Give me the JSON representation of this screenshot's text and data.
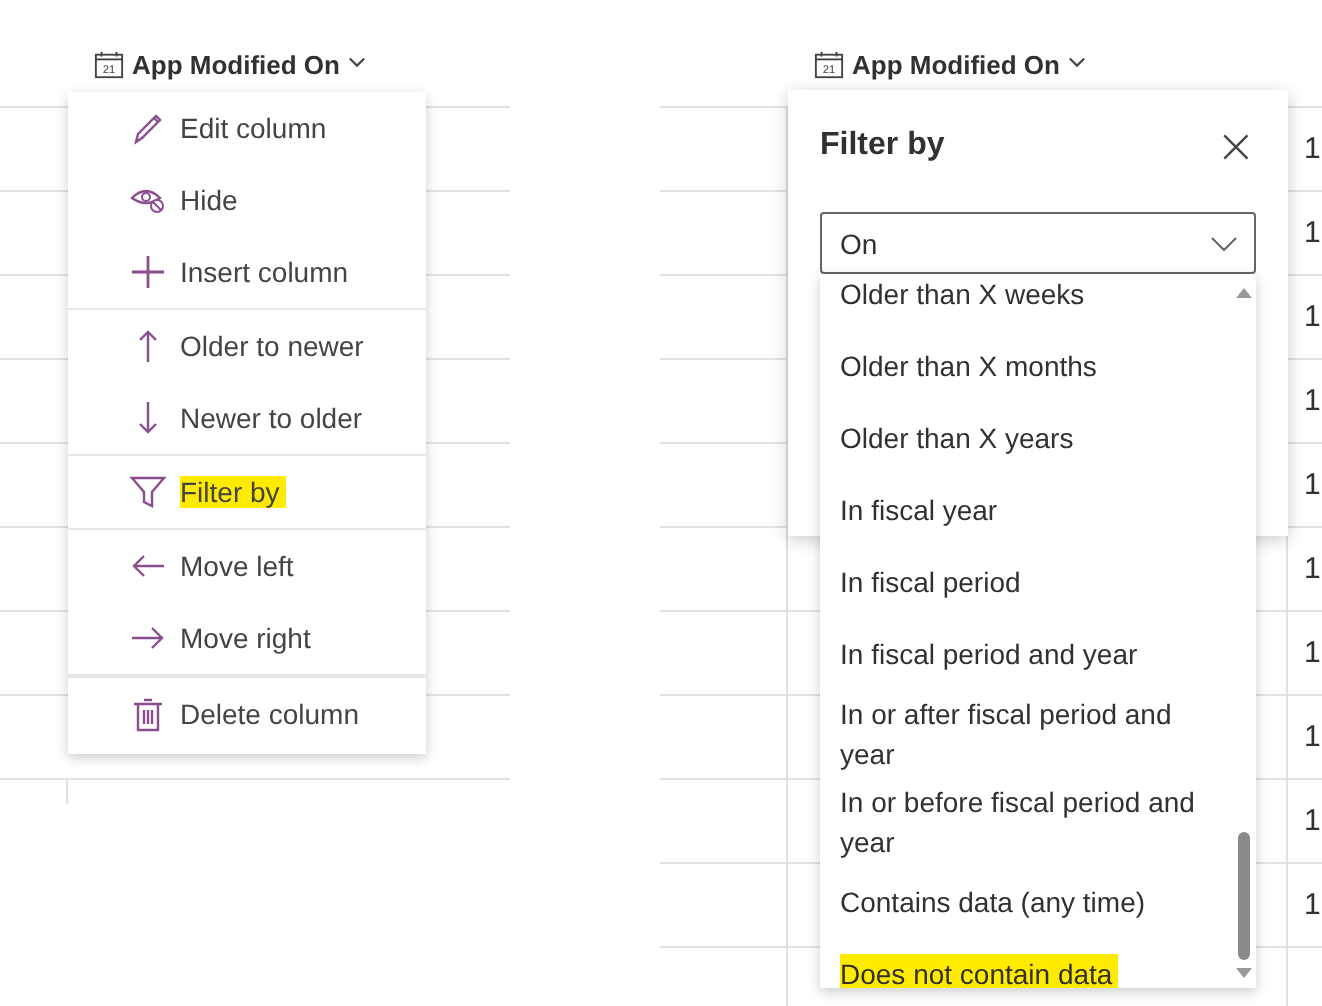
{
  "left": {
    "column_header": {
      "label": "App Modified On",
      "calendar_day": "21"
    },
    "menu": {
      "groups": [
        [
          {
            "kind": "edit",
            "label": "Edit column",
            "highlighted": false
          },
          {
            "kind": "hide",
            "label": "Hide",
            "highlighted": false
          },
          {
            "kind": "insert",
            "label": "Insert column",
            "highlighted": false
          }
        ],
        [
          {
            "kind": "up",
            "label": "Older to newer",
            "highlighted": false
          },
          {
            "kind": "down",
            "label": "Newer to older",
            "highlighted": false
          }
        ],
        [
          {
            "kind": "filter",
            "label": "Filter by",
            "highlighted": true
          }
        ],
        [
          {
            "kind": "left",
            "label": "Move left",
            "highlighted": false
          },
          {
            "kind": "right",
            "label": "Move right",
            "highlighted": false
          }
        ],
        [
          {
            "kind": "delete",
            "label": "Delete column",
            "highlighted": false
          }
        ]
      ]
    }
  },
  "right": {
    "column_header": {
      "label": "App Modified On",
      "calendar_day": "21"
    },
    "filter_panel": {
      "title": "Filter by",
      "close": "×",
      "select": {
        "value": "On"
      },
      "options": [
        {
          "label": "Older than X weeks",
          "highlighted": false
        },
        {
          "label": "Older than X months",
          "highlighted": false
        },
        {
          "label": "Older than X years",
          "highlighted": false
        },
        {
          "label": "In fiscal year",
          "highlighted": false
        },
        {
          "label": "In fiscal period",
          "highlighted": false
        },
        {
          "label": "In fiscal period and year",
          "highlighted": false
        },
        {
          "label": "In or after fiscal period and year",
          "highlighted": false
        },
        {
          "label": "In or before fiscal period and year",
          "highlighted": false
        },
        {
          "label": "Contains data (any time)",
          "highlighted": false
        },
        {
          "label": "Does not contain data",
          "highlighted": true
        }
      ]
    },
    "column_3": [
      "1",
      "1",
      "1",
      "1",
      "1",
      "1",
      "1",
      "1",
      "1",
      "1"
    ]
  }
}
